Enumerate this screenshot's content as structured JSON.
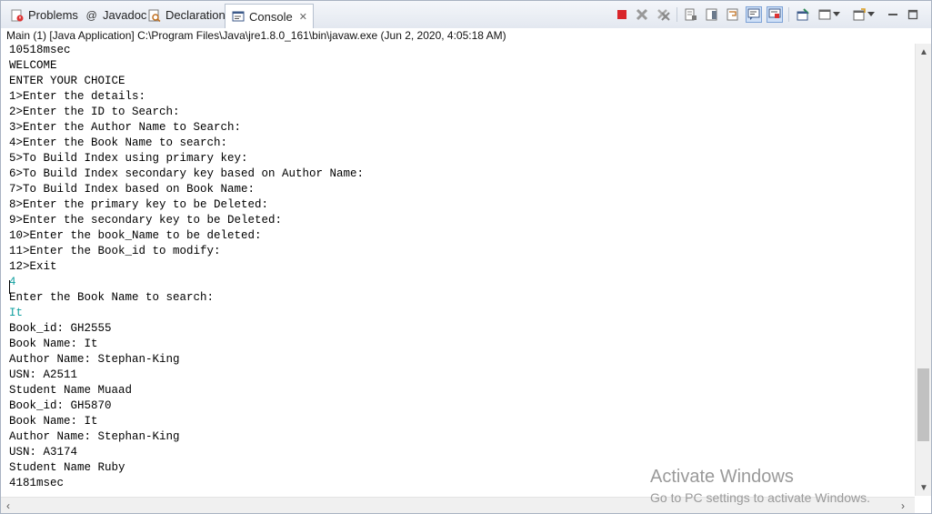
{
  "tabs": [
    {
      "label": "Problems",
      "icon": "problems-icon"
    },
    {
      "label": "Javadoc",
      "icon": "at-icon"
    },
    {
      "label": "Declaration",
      "icon": "declaration-icon"
    },
    {
      "label": "Console",
      "icon": "console-icon",
      "active": true
    }
  ],
  "toolbar": {
    "buttons": [
      "terminate-icon",
      "remove-launch-icon",
      "remove-all-terminated-icon",
      "clear-console-icon",
      "scroll-lock-icon",
      "word-wrap-icon",
      "show-on-stdout-icon",
      "show-on-stderr-icon",
      "pin-console-icon",
      "display-selected-console-icon",
      "open-console-icon"
    ],
    "minimize": "minimize-icon",
    "maximize": "maximize-icon"
  },
  "console": {
    "description": "Main (1) [Java Application] C:\\Program Files\\Java\\jre1.8.0_161\\bin\\javaw.exe (Jun 2, 2020, 4:05:18 AM)",
    "lines": [
      {
        "text": "10518msec",
        "type": "out"
      },
      {
        "text": "WELCOME",
        "type": "out"
      },
      {
        "text": "ENTER YOUR CHOICE",
        "type": "out"
      },
      {
        "text": "1>Enter the details:",
        "type": "out"
      },
      {
        "text": "2>Enter the ID to Search:",
        "type": "out"
      },
      {
        "text": "3>Enter the Author Name to Search:",
        "type": "out"
      },
      {
        "text": "4>Enter the Book Name to search:",
        "type": "out"
      },
      {
        "text": "5>To Build Index using primary key:",
        "type": "out"
      },
      {
        "text": "6>To Build Index secondary key based on Author Name:",
        "type": "out"
      },
      {
        "text": "7>To Build Index based on Book Name:",
        "type": "out"
      },
      {
        "text": "8>Enter the primary key to be Deleted:",
        "type": "out"
      },
      {
        "text": "9>Enter the secondary key to be Deleted:",
        "type": "out"
      },
      {
        "text": "10>Enter the book_Name to be deleted:",
        "type": "out"
      },
      {
        "text": "11>Enter the Book_id to modify:",
        "type": "out"
      },
      {
        "text": "12>Exit",
        "type": "out"
      },
      {
        "text": "4",
        "type": "in"
      },
      {
        "text": "Enter the Book Name to search:",
        "type": "out"
      },
      {
        "text": "It",
        "type": "in"
      },
      {
        "text": "Book_id: GH2555",
        "type": "out"
      },
      {
        "text": "Book Name: It",
        "type": "out"
      },
      {
        "text": "Author Name: Stephan-King",
        "type": "out"
      },
      {
        "text": "USN: A2511",
        "type": "out"
      },
      {
        "text": "Student Name Muaad",
        "type": "out"
      },
      {
        "text": "Book_id: GH5870",
        "type": "out"
      },
      {
        "text": "Book Name: It",
        "type": "out"
      },
      {
        "text": "Author Name: Stephan-King",
        "type": "out"
      },
      {
        "text": "USN: A3174",
        "type": "out"
      },
      {
        "text": "Student Name Ruby",
        "type": "out"
      },
      {
        "text": "4181msec",
        "type": "out"
      }
    ]
  },
  "watermark": {
    "title": "Activate Windows",
    "subtitle": "Go to PC settings to activate Windows."
  },
  "colors": {
    "output_text": "#000000",
    "input_text": "#12a0a0",
    "accent": "#7da2d6"
  }
}
